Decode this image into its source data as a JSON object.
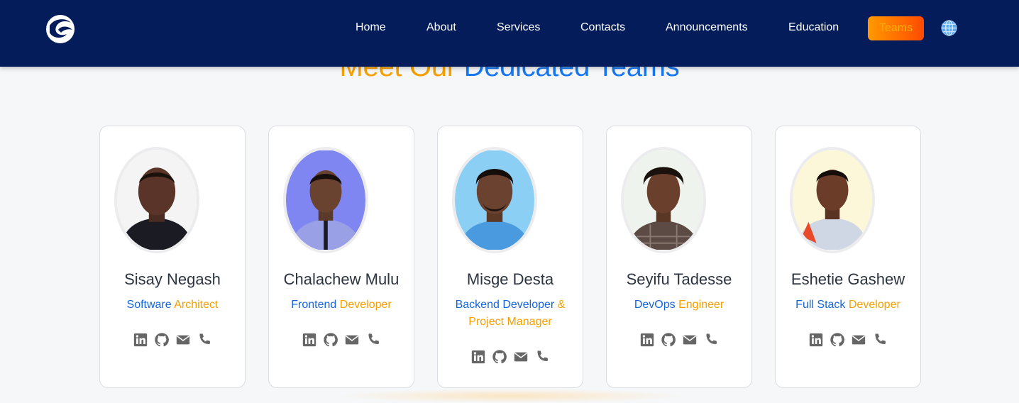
{
  "nav": {
    "items": [
      "Home",
      "About",
      "Services",
      "Contacts",
      "Announcements",
      "Education"
    ],
    "active": "Teams"
  },
  "hero": {
    "title_part1": "Meet Our",
    "title_part2": "Dedicated Teams"
  },
  "colors": {
    "navbar": "#041c5a",
    "accent_blue": "#1565d8",
    "accent_orange": "#f5a000",
    "active_gradient_start": "#ff9a00",
    "active_gradient_end": "#ff4a00"
  },
  "team": [
    {
      "name": "Sisay Negash",
      "role_a": "Software",
      "role_b": "Architect",
      "role_c": ""
    },
    {
      "name": "Chalachew Mulu",
      "role_a": "Frontend",
      "role_b": "Developer",
      "role_c": ""
    },
    {
      "name": "Misge Desta",
      "role_a": "Backend Developer",
      "role_b": "&",
      "role_c": "Project Manager"
    },
    {
      "name": "Seyifu Tadesse",
      "role_a": "DevOps",
      "role_b": "Engineer",
      "role_c": ""
    },
    {
      "name": "Eshetie Gashew",
      "role_a": "Full Stack",
      "role_b": "Developer",
      "role_c": ""
    }
  ],
  "icons": [
    "linkedin-icon",
    "github-icon",
    "mail-icon",
    "phone-icon"
  ]
}
